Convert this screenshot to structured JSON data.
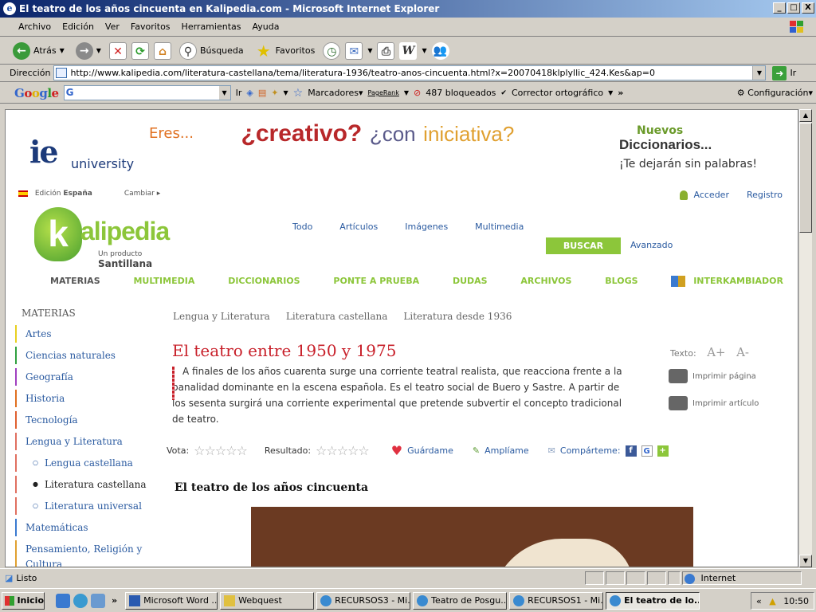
{
  "window": {
    "title": "El teatro de los años cincuenta en Kalipedia.com - Microsoft Internet Explorer",
    "minimize": "_",
    "maximize": "□",
    "close": "X"
  },
  "menu": [
    "Archivo",
    "Edición",
    "Ver",
    "Favoritos",
    "Herramientas",
    "Ayuda"
  ],
  "toolbar": {
    "back": "Atrás",
    "search": "Búsqueda",
    "favorites": "Favoritos"
  },
  "address": {
    "label": "Dirección",
    "url": "http://www.kalipedia.com/literatura-castellana/tema/literatura-1936/teatro-anos-cincuenta.html?x=20070418klplyllic_424.Kes&ap=0",
    "go": "Ir"
  },
  "googlebar": {
    "logo": "Google",
    "go": "Ir",
    "bookmarks": "Marcadores▾",
    "pagerank": "PageRank",
    "blocked": "487 bloqueados",
    "spell": "Corrector ortográfico",
    "more": "»",
    "settings": "Configuración▾"
  },
  "page": {
    "ad_left": {
      "mark": "ie",
      "text": "university"
    },
    "banner": {
      "eres": "Eres...",
      "creativo": "¿creativo?",
      "con": "¿con",
      "iniciativa": "iniciativa?"
    },
    "ad_right": {
      "nuevos": "Nuevos",
      "diccionarios": "Diccionarios...",
      "tagline": "¡Te dejarán sin palabras!"
    },
    "edition": {
      "label": "Edición",
      "country": "España",
      "change": "Cambiar"
    },
    "login": {
      "access": "Acceder",
      "register": "Registro"
    },
    "brand": {
      "k": "k",
      "name": "alipedia",
      "sub": "Un producto",
      "sub_brand": "Santillana"
    },
    "search_tabs": [
      "Todo",
      "Artículos",
      "Imágenes",
      "Multimedia"
    ],
    "search_button": "BUSCAR",
    "advanced": "Avanzado",
    "nav": [
      "MATERIAS",
      "MULTIMEDIA",
      "DICCIONARIOS",
      "PONTE A PRUEBA",
      "DUDAS",
      "ARCHIVOS",
      "BLOGS",
      "INTERKAMBIADOR"
    ],
    "sidebar": {
      "header": "MATERIAS",
      "items": [
        {
          "label": "Artes",
          "color": "#e8d020"
        },
        {
          "label": "Ciencias naturales",
          "color": "#30a040"
        },
        {
          "label": "Geografía",
          "color": "#a040c0"
        },
        {
          "label": "Historia",
          "color": "#e07020"
        },
        {
          "label": "Tecnología",
          "color": "#e06030"
        },
        {
          "label": "Lengua y Literatura",
          "color": "#e07060"
        }
      ],
      "sub_items": [
        "Lengua castellana",
        "Literatura castellana",
        "Literatura universal"
      ],
      "items2": [
        {
          "label": "Matemáticas",
          "color": "#3a7ad0"
        },
        {
          "label": "Pensamiento, Religión y",
          "color": "#e0a030"
        },
        {
          "label": "Cultura",
          "color": "#e0a030"
        }
      ]
    },
    "breadcrumbs": [
      "Lengua y Literatura",
      "Literatura castellana",
      "Literatura desde 1936"
    ],
    "article": {
      "title": "El teatro entre 1950 y 1975",
      "intro": "A finales de los años cuarenta surge una corriente teatral realista, que reacciona frente a la banalidad dominante en la escena española. Es el teatro social de Buero y Sastre. A partir de los sesenta surgirá una corriente experimental que pretende subvertir el concepto tradicional de teatro.",
      "section_title": "El teatro de los años cincuenta"
    },
    "tools": {
      "text_label": "Texto:",
      "bigger": "A+",
      "smaller": "A-",
      "print_page": "Imprimir página",
      "print_article": "Imprimir artículo"
    },
    "vote": {
      "label": "Vota:",
      "result": "Resultado:",
      "save": "Guárdame",
      "expand": "Amplíame",
      "share": "Compárteme:"
    }
  },
  "status": {
    "text": "Listo",
    "zone": "Internet"
  },
  "taskbar": {
    "start": "Inicio",
    "tasks": [
      "Microsoft Word ...",
      "Webquest",
      "RECURSOS3 - Mi...",
      "Teatro de Posgu...",
      "RECURSOS1 - Mi...",
      "El teatro de lo..."
    ],
    "more": "»",
    "clock": "10:50"
  }
}
